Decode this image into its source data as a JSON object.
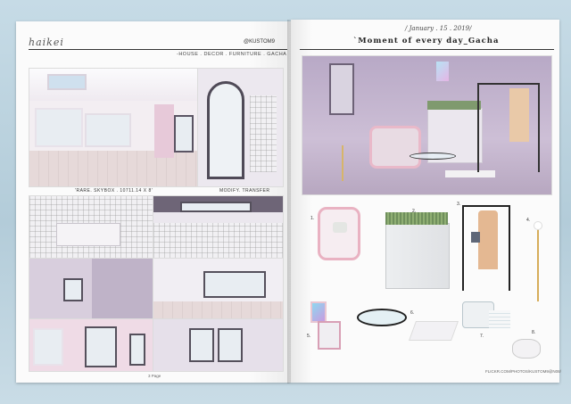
{
  "left_page": {
    "brand": "haikei",
    "handle": "@KUSTOM9",
    "tagline": "-HOUSE . DECOR . FURNITURE . GACHA",
    "caption_product": "'RARE. SKYBOX . 10711.14 X 8'",
    "caption_perm": "MODIFY. TRANSFER",
    "page_number": "3 Page"
  },
  "right_page": {
    "date": "/ January . 15 . 2019/",
    "title": "`Moment of every day_Gacha",
    "item_numbers": [
      "1.",
      "2.",
      "3.",
      "4.",
      "5.",
      "6.",
      "7.",
      "8."
    ],
    "footer": "FLICKR.COM/PHOTOS/KUSTOM9@N08/"
  },
  "colors": {
    "background": "#c6dbe6",
    "paper": "#fbfbfb",
    "room_pink": "#e9dbe6",
    "room_purple": "#a89ab3",
    "frame_dark": "#55505c"
  }
}
